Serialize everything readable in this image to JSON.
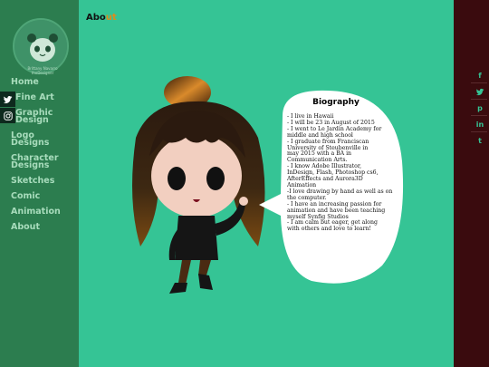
{
  "brand": {
    "name": "Brittany Navarro",
    "tagline": "theDesigner"
  },
  "nav": [
    {
      "label": "Home",
      "key": "home"
    },
    {
      "label": "Fine Art",
      "key": "fine-art"
    },
    {
      "label": "Graphic Design",
      "key": "graphic-design"
    },
    {
      "label": "Logo Designs",
      "key": "logo-designs"
    },
    {
      "label": "Character Designs",
      "key": "character-designs"
    },
    {
      "label": "Sketches",
      "key": "sketches"
    },
    {
      "label": "Comic",
      "key": "comic"
    },
    {
      "label": "Animation",
      "key": "animation"
    },
    {
      "label": "About",
      "key": "about"
    }
  ],
  "page": {
    "title_main": "Abo",
    "title_accent": "ut"
  },
  "bio": {
    "title": "Biography",
    "lines": [
      "- I live in Hawaii",
      "- I will be 23 in August of 2015",
      "- I went to Le Jardin Academy for",
      "middle and high school",
      "- I graduate from Franciscan",
      "University of Steubenville in",
      "may 2015 with a BA in",
      "Communication Arts.",
      "- I know Adobe Illustrator,",
      "InDesign, Flash, Photoshop cs6,",
      "AfterEffects and Aurora3D",
      "Animation",
      "-I love drawing by hand as well as on",
      "the computer.",
      "- I have an increasing passion for",
      "animation and have been teaching",
      "myself Synfig Studios",
      "- I am calm but eager, get along",
      "with others and love to learn!"
    ]
  },
  "social_left": [
    {
      "icon": "twitter-icon",
      "glyph": "t"
    },
    {
      "icon": "instagram-icon",
      "glyph": "◎"
    }
  ],
  "social_right": [
    {
      "icon": "facebook-icon",
      "glyph": "f"
    },
    {
      "icon": "twitter-icon",
      "glyph": "t"
    },
    {
      "icon": "pinterest-icon",
      "glyph": "p"
    },
    {
      "icon": "linkedin-icon",
      "glyph": "in"
    },
    {
      "icon": "tumblr-icon",
      "glyph": "t"
    }
  ],
  "colors": {
    "background": "#35c495",
    "sidebar": "#2c7d4f",
    "right_bar": "#3a0b0e",
    "accent": "#e08a1a"
  }
}
